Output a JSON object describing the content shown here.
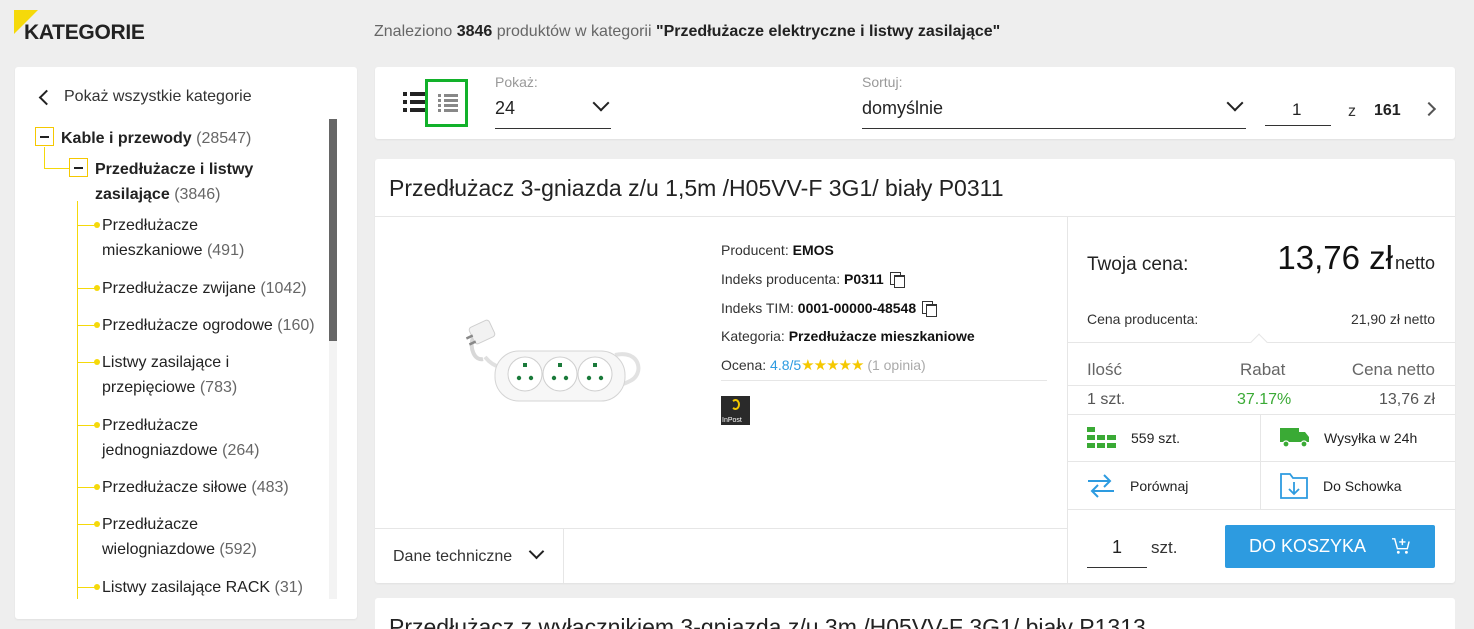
{
  "header": {
    "kategorie": "KATEGORIE",
    "found_prefix": "Znaleziono",
    "found_count": "3846",
    "found_middle": "produktów w kategorii",
    "found_category": "\"Przedłużacze elektryczne i listwy zasilające\""
  },
  "sidebar": {
    "show_all": "Pokaż wszystkie kategorie",
    "root": {
      "label": "Kable i przewody",
      "count": "(28547)"
    },
    "current": {
      "label_line1": "Przedłużacze i listwy",
      "label_line2": "zasilające",
      "count": "(3846)"
    },
    "items": [
      {
        "line1": "Przedłużacze",
        "line2": "mieszkaniowe",
        "count": "(491)"
      },
      {
        "line1": "Przedłużacze zwijane",
        "line2": "",
        "count": "(1042)"
      },
      {
        "line1": "Przedłużacze ogrodowe",
        "line2": "",
        "count": "(160)"
      },
      {
        "line1": "Listwy zasilające i",
        "line2": "przepięciowe",
        "count": "(783)"
      },
      {
        "line1": "Przedłużacze",
        "line2": "jednogniazdowe",
        "count": "(264)"
      },
      {
        "line1": "Przedłużacze siłowe",
        "line2": "",
        "count": "(483)"
      },
      {
        "line1": "Przedłużacze",
        "line2": "wielogniazdowe",
        "count": "(592)"
      },
      {
        "line1": "Listwy zasilające RACK",
        "line2": "",
        "count": "(31)"
      }
    ]
  },
  "toolbar": {
    "show_label": "Pokaż:",
    "show_value": "24",
    "sort_label": "Sortuj:",
    "sort_value": "domyślnie",
    "page_current": "1",
    "page_of": "z",
    "page_total": "161"
  },
  "product": {
    "title": "Przedłużacz 3-gniazda z/u 1,5m /H05VV-F 3G1/ biały P0311",
    "producer_label": "Producent:",
    "producer": "EMOS",
    "producer_index_label": "Indeks producenta:",
    "producer_index": "P0311",
    "tim_index_label": "Indeks TIM:",
    "tim_index": "0001-00000-48548",
    "category_label": "Kategoria:",
    "category": "Przedłużacze mieszkaniowe",
    "rating_label": "Ocena:",
    "rating": "4.8/5",
    "stars": "★★★★★",
    "reviews": "(1 opinia)",
    "courier_logo_text": "InPost",
    "tech_data": "Dane techniczne",
    "your_price_label": "Twoja cena:",
    "price": "13,76 zł",
    "price_net": "netto",
    "producer_price_label": "Cena producenta:",
    "producer_price": "21,90 zł netto",
    "table_headers": [
      "Ilość",
      "Rabat",
      "Cena netto"
    ],
    "table_row": [
      "1 szt.",
      "37.17%",
      "13,76 zł"
    ],
    "stock": "559 szt.",
    "shipping": "Wysyłka w 24h",
    "compare": "Porównaj",
    "clipboard": "Do Schowka",
    "qty": "1",
    "qty_unit": "szt.",
    "add_to_cart": "DO KOSZYKA"
  },
  "product2": {
    "title": "Przedłużacz z wyłącznikiem 3-gniazda z/u 3m /H05VV-F 3G1/ biały P1313"
  },
  "colors": {
    "accent_yellow": "#f5d90a",
    "button_blue": "#2d9be0",
    "discount_green": "#3aaa35",
    "selected_view_border": "#12b12a"
  }
}
